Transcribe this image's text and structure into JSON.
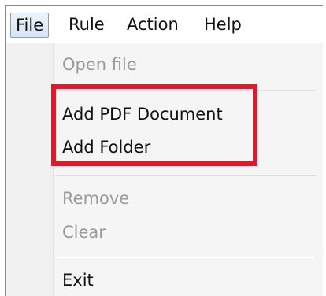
{
  "menubar": {
    "items": [
      {
        "label": "File",
        "active": true
      },
      {
        "label": "Rule"
      },
      {
        "label": "Action"
      },
      {
        "label": "Help"
      }
    ]
  },
  "file_menu": {
    "items": [
      {
        "label": "Open file",
        "enabled": false
      },
      {
        "label": "Add PDF Document",
        "enabled": true
      },
      {
        "label": "Add Folder",
        "enabled": true
      },
      {
        "label": "Remove",
        "enabled": false
      },
      {
        "label": "Clear",
        "enabled": false
      },
      {
        "label": "Exit",
        "enabled": true
      }
    ]
  },
  "colors": {
    "annotation_box": "#e0192e",
    "active_menu_border": "#7da2ce",
    "disabled_text": "#9a9a9a"
  }
}
